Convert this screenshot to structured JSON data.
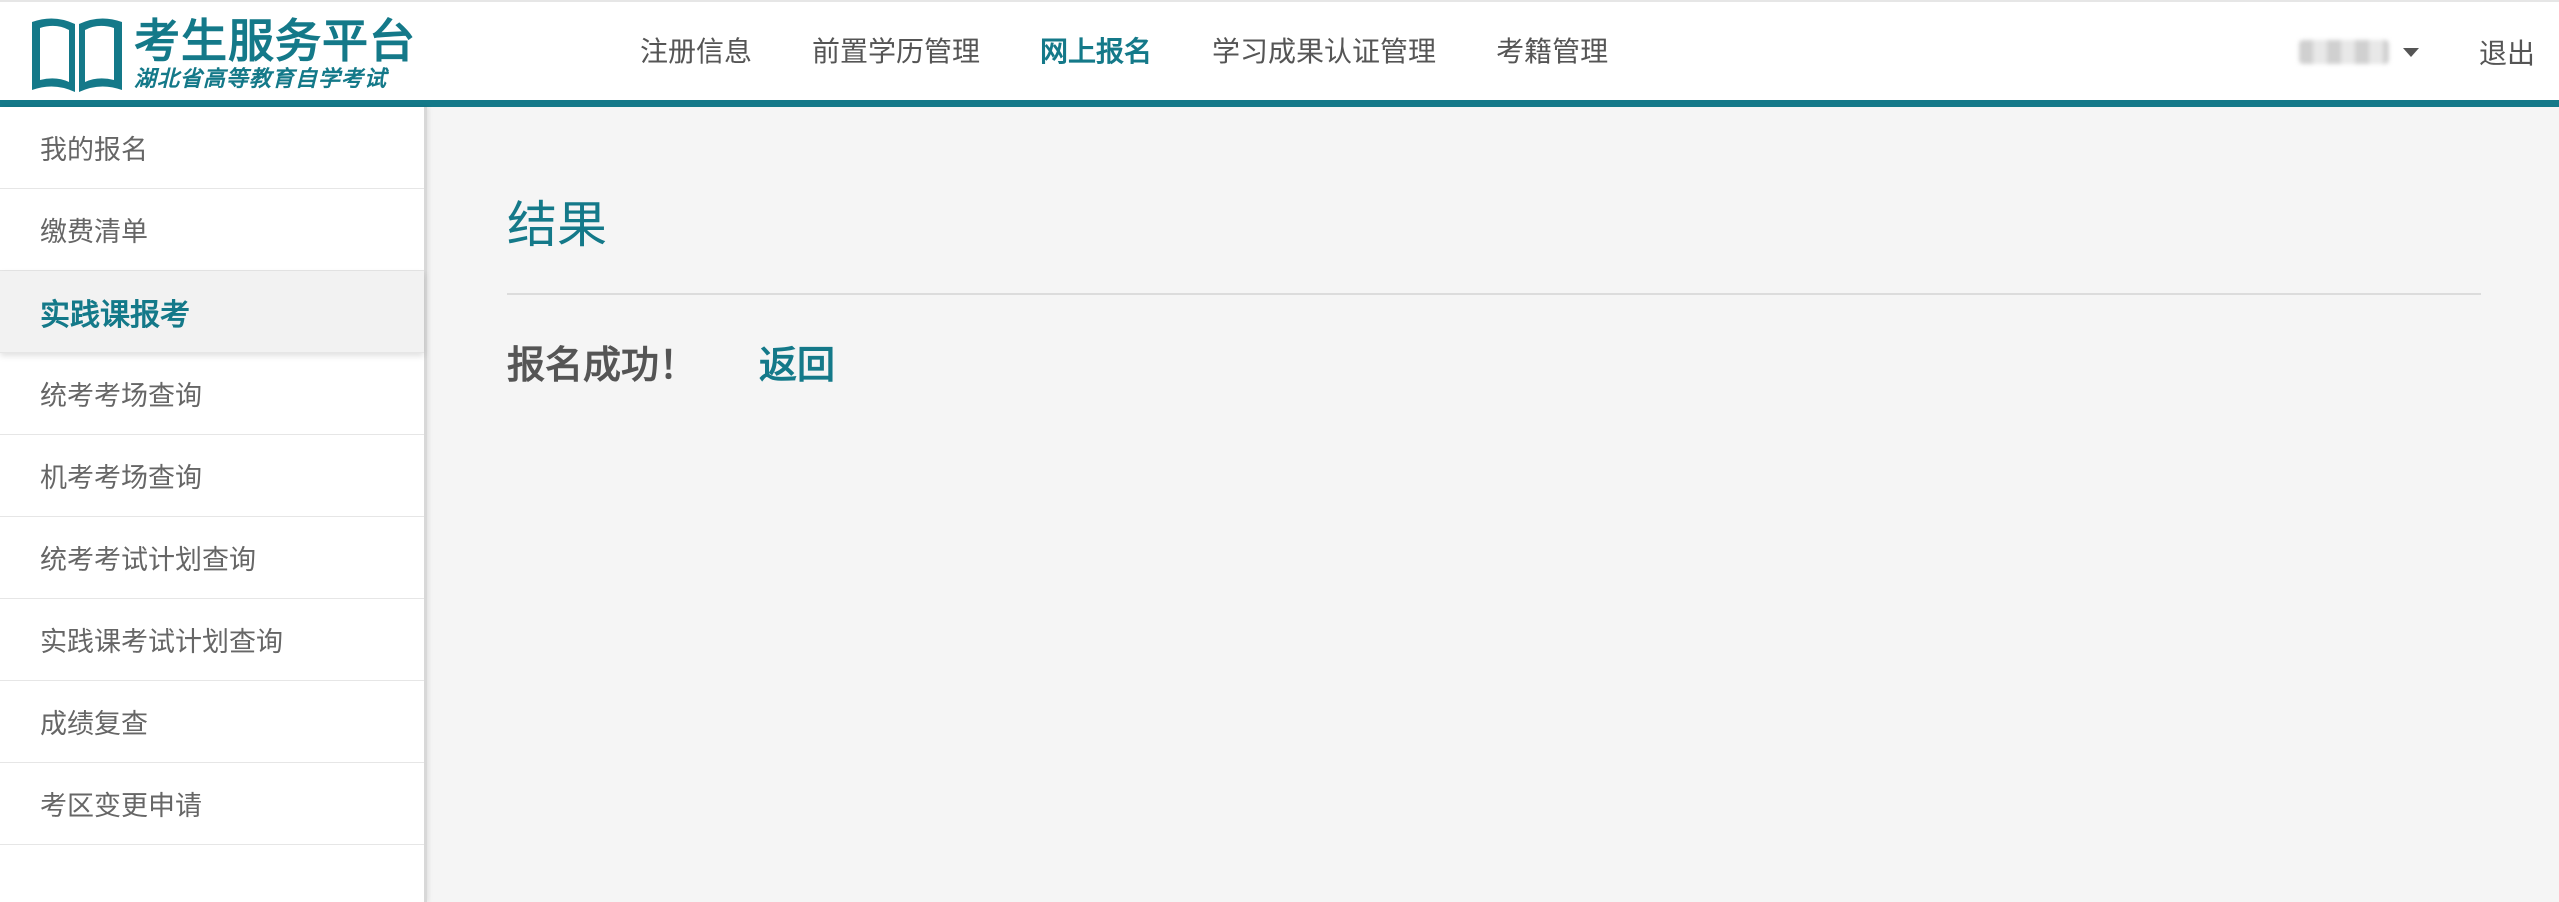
{
  "header": {
    "logo_title": "考生服务平台",
    "logo_subtitle": "湖北省高等教育自学考试",
    "logo_icon": "open-book-icon",
    "nav": [
      {
        "label": "注册信息",
        "active": false
      },
      {
        "label": "前置学历管理",
        "active": false
      },
      {
        "label": "网上报名",
        "active": true
      },
      {
        "label": "学习成果认证管理",
        "active": false
      },
      {
        "label": "考籍管理",
        "active": false
      }
    ],
    "user_menu_icon": "caret-down-icon",
    "logout_label": "退出"
  },
  "sidebar": {
    "items": [
      {
        "label": "我的报名",
        "active": false
      },
      {
        "label": "缴费清单",
        "active": false
      },
      {
        "label": "实践课报考",
        "active": true
      },
      {
        "label": "统考考场查询",
        "active": false
      },
      {
        "label": "机考考场查询",
        "active": false
      },
      {
        "label": "统考考试计划查询",
        "active": false
      },
      {
        "label": "实践课考试计划查询",
        "active": false
      },
      {
        "label": "成绩复查",
        "active": false
      },
      {
        "label": "考区变更申请",
        "active": false
      }
    ]
  },
  "main": {
    "title": "结果",
    "message": "报名成功！",
    "back_label": "返回"
  },
  "colors": {
    "accent": "#147989",
    "background": "#f5f5f5",
    "text": "#555555"
  }
}
